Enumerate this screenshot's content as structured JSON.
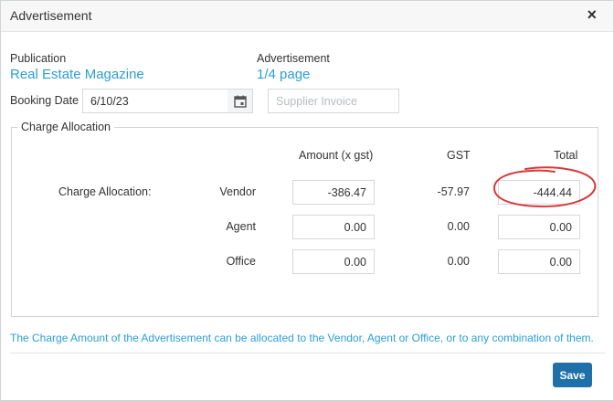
{
  "dialog": {
    "title": "Advertisement",
    "close_label": "×"
  },
  "publication": {
    "label": "Publication",
    "value": "Real Estate Magazine"
  },
  "advertisement": {
    "label": "Advertisement",
    "value": "1/4 page"
  },
  "booking": {
    "label": "Booking Date",
    "value": "6/10/23",
    "calendar_icon": "calendar-icon"
  },
  "supplier_invoice": {
    "placeholder": "Supplier Invoice",
    "value": ""
  },
  "charge_allocation": {
    "legend": "Charge Allocation",
    "row_label": "Charge Allocation:",
    "headers": {
      "amount": "Amount (x gst)",
      "gst": "GST",
      "total": "Total"
    },
    "rows": [
      {
        "party": "Vendor",
        "amount": "-386.47",
        "gst": "-57.97",
        "total": "-444.44"
      },
      {
        "party": "Agent",
        "amount": "0.00",
        "gst": "0.00",
        "total": "0.00"
      },
      {
        "party": "Office",
        "amount": "0.00",
        "gst": "0.00",
        "total": "0.00"
      }
    ]
  },
  "note": "The Charge Amount of the Advertisement can be allocated to the Vendor, Agent or Office, or to any combination of them.",
  "footer": {
    "save_label": "Save"
  },
  "colors": {
    "accent": "#2a9fd6",
    "button": "#1f6fa8",
    "annotation": "#d9383a"
  }
}
